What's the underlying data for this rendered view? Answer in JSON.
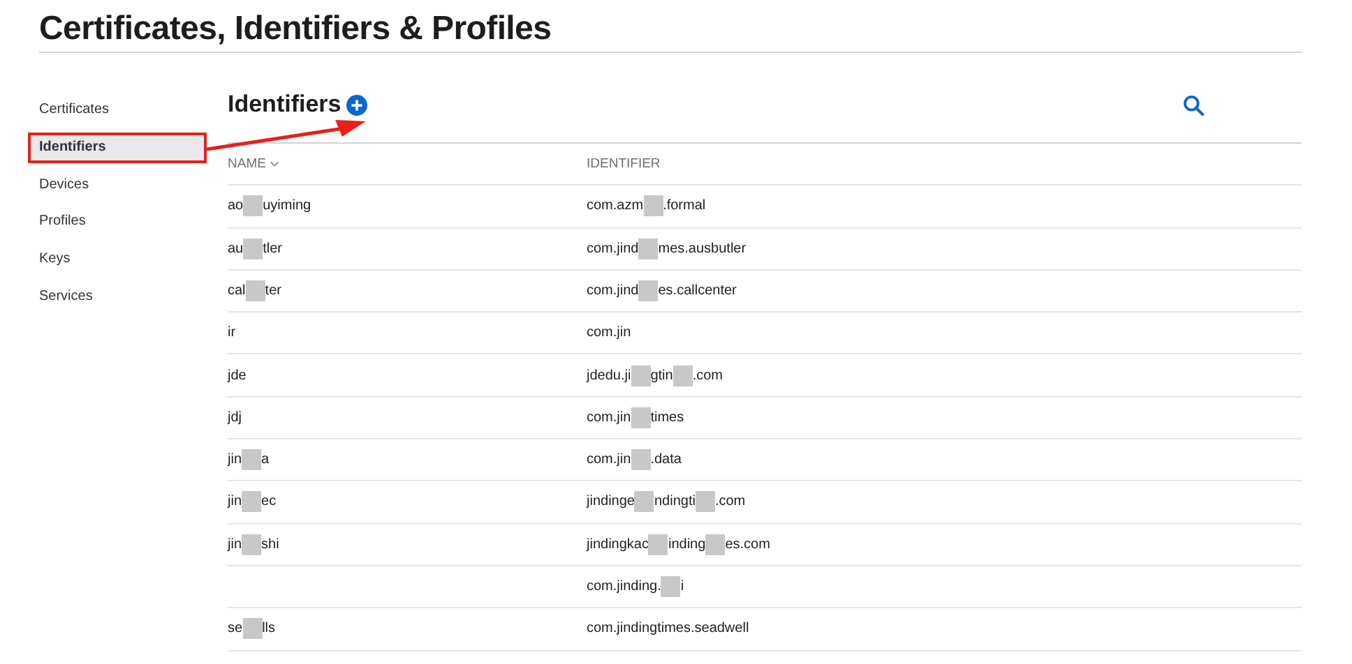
{
  "page_title": "Certificates, Identifiers & Profiles",
  "sidebar": {
    "items": [
      {
        "label": "Certificates",
        "selected": false,
        "highlighted": false
      },
      {
        "label": "Identifiers",
        "selected": true,
        "highlighted": true
      },
      {
        "label": "Devices",
        "selected": false,
        "highlighted": false
      },
      {
        "label": "Profiles",
        "selected": false,
        "highlighted": false
      },
      {
        "label": "Keys",
        "selected": false,
        "highlighted": false
      },
      {
        "label": "Services",
        "selected": false,
        "highlighted": false
      }
    ]
  },
  "heading": "Identifiers",
  "table": {
    "columns": [
      {
        "label": "NAME",
        "sorted": true
      },
      {
        "label": "IDENTIFIER",
        "sorted": false
      }
    ],
    "rows": [
      {
        "name": [
          "ao",
          "uyiming"
        ],
        "identifier": [
          "com.azm",
          ".formal"
        ]
      },
      {
        "name": [
          "au",
          "tler"
        ],
        "identifier": [
          "com.jind",
          "mes.ausbutler"
        ]
      },
      {
        "name": [
          "cal",
          "ter"
        ],
        "identifier": [
          "com.jind",
          "es.callcenter"
        ]
      },
      {
        "name": [
          "ir"
        ],
        "identifier": [
          "com.jin"
        ]
      },
      {
        "name": [
          "jde"
        ],
        "identifier": [
          "jdedu.ji",
          "gtin",
          ".com"
        ]
      },
      {
        "name": [
          "jdj"
        ],
        "identifier": [
          "com.jin",
          "times"
        ]
      },
      {
        "name": [
          "jin",
          "a"
        ],
        "identifier": [
          "com.jin",
          ".data"
        ]
      },
      {
        "name": [
          "jin",
          "ec"
        ],
        "identifier": [
          "jindinge",
          "ndingti",
          ".com"
        ]
      },
      {
        "name": [
          "jin",
          "shi"
        ],
        "identifier": [
          "jindingkac",
          "inding",
          "es.com"
        ]
      },
      {
        "identifier": [
          "com.jinding.",
          "i"
        ]
      },
      {
        "name": [
          "se",
          "lls"
        ],
        "identifier": [
          "com.jindingtimes.seadwell"
        ]
      }
    ]
  }
}
